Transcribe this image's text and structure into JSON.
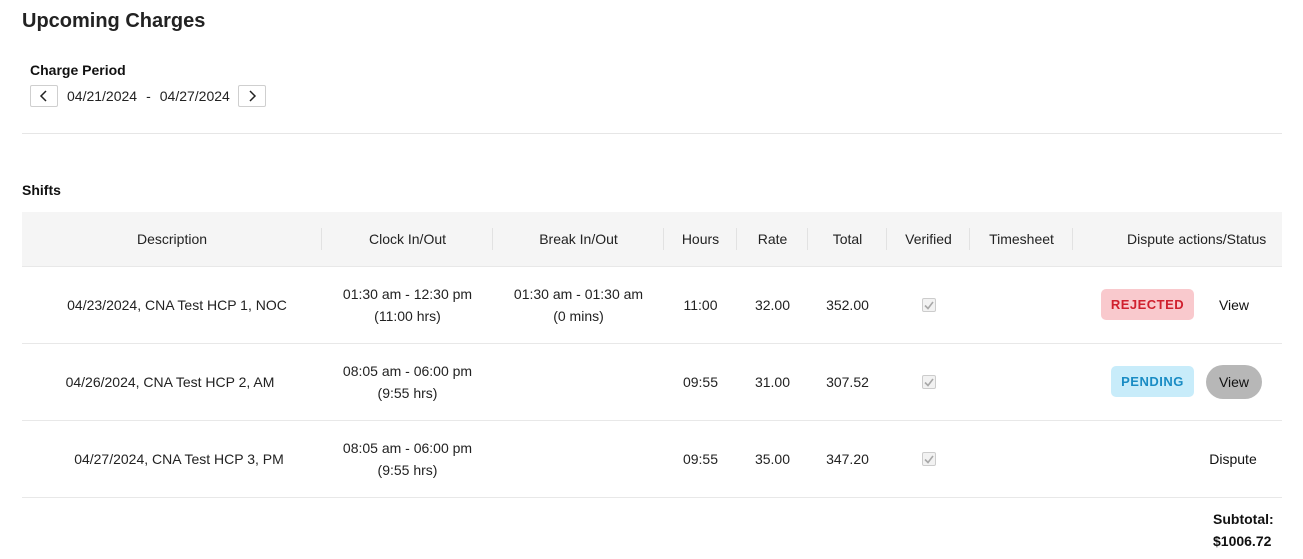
{
  "page": {
    "title": "Upcoming Charges"
  },
  "charge_period": {
    "label": "Charge Period",
    "start_date": "04/21/2024",
    "separator": "-",
    "end_date": "04/27/2024",
    "prev_icon": "chevron-left-icon",
    "next_icon": "chevron-right-icon"
  },
  "shifts": {
    "section_title": "Shifts",
    "columns": {
      "description": "Description",
      "clock": "Clock In/Out",
      "break": "Break In/Out",
      "hours": "Hours",
      "rate": "Rate",
      "total": "Total",
      "verified": "Verified",
      "timesheet": "Timesheet",
      "dispute": "Dispute actions/Status"
    },
    "rows": [
      {
        "description": "04/23/2024, CNA  Test HCP 1, NOC",
        "clock_range": "01:30 am - 12:30 pm",
        "clock_duration": "(11:00 hrs)",
        "break_range": "01:30 am - 01:30 am",
        "break_duration": "(0 mins)",
        "hours": "11:00",
        "rate": "32.00",
        "total": "352.00",
        "verified": true,
        "timesheet": "",
        "status": "REJECTED",
        "status_color": "#d0202e",
        "action": "View"
      },
      {
        "description": "04/26/2024, CNA   Test HCP 2, AM",
        "clock_range": "08:05 am - 06:00 pm",
        "clock_duration": "(9:55 hrs)",
        "break_range": "",
        "break_duration": "",
        "hours": "09:55",
        "rate": "31.00",
        "total": "307.52",
        "verified": true,
        "timesheet": "",
        "status": "PENDING",
        "status_color": "#1a8cc4",
        "action": "View"
      },
      {
        "description": "04/27/2024, CNA  Test HCP 3, PM",
        "clock_range": "08:05 am - 06:00 pm",
        "clock_duration": "(9:55 hrs)",
        "break_range": "",
        "break_duration": "",
        "hours": "09:55",
        "rate": "35.00",
        "total": "347.20",
        "verified": true,
        "timesheet": "",
        "status": "",
        "action": "Dispute"
      }
    ]
  },
  "subtotal": {
    "label": "Subtotal:",
    "value": "$1006.72"
  }
}
